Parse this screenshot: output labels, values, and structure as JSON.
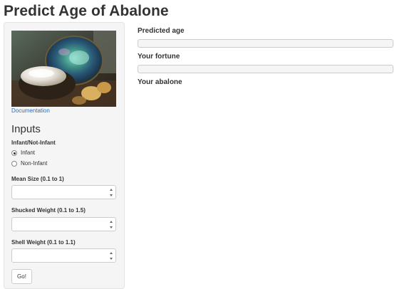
{
  "app": {
    "title": "Predict Age of Abalone"
  },
  "sidebar": {
    "image_alt_icon": "abalone-photo",
    "documentation_link": "Documentation",
    "inputs_heading": "Inputs",
    "infant_group": {
      "label": "Infant/Not-Infant",
      "options": [
        "Infant",
        "Non-Infant"
      ],
      "selected": "Infant"
    },
    "mean_size": {
      "label": "Mean Size (0.1 to 1)",
      "value": ""
    },
    "shucked_weight": {
      "label": "Shucked Weight (0.1 to 1.5)",
      "value": ""
    },
    "shell_weight": {
      "label": "Shell Weight (0.1 to 1.1)",
      "value": ""
    },
    "go_label": "Go!"
  },
  "main": {
    "predicted_age_label": "Predicted age",
    "predicted_age_value": "",
    "fortune_label": "Your fortune",
    "fortune_value": "",
    "abalone_label": "Your abalone"
  },
  "colors": {
    "sidebar_bg": "#f5f5f5",
    "link": "#2a6db5",
    "text": "#333333",
    "output_bg": "#f5f5f5"
  }
}
